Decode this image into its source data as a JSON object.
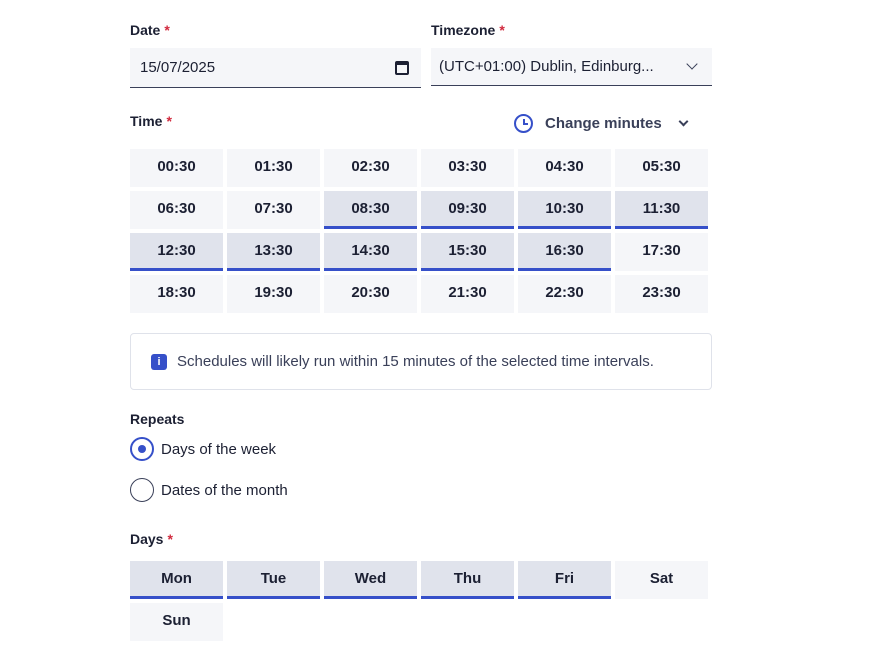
{
  "date": {
    "label": "Date",
    "required_mark": "*",
    "value": "15/07/2025",
    "icon": "calendar-icon"
  },
  "timezone": {
    "label": "Timezone",
    "required_mark": "*",
    "value": "(UTC+01:00) Dublin, Edinburg...",
    "icon": "chevron-down-icon"
  },
  "time": {
    "label": "Time",
    "required_mark": "*",
    "change_minutes": {
      "label": "Change minutes",
      "icon": "clock-icon"
    },
    "slots": [
      {
        "label": "00:30",
        "selected": false
      },
      {
        "label": "01:30",
        "selected": false
      },
      {
        "label": "02:30",
        "selected": false
      },
      {
        "label": "03:30",
        "selected": false
      },
      {
        "label": "04:30",
        "selected": false
      },
      {
        "label": "05:30",
        "selected": false
      },
      {
        "label": "06:30",
        "selected": false
      },
      {
        "label": "07:30",
        "selected": false
      },
      {
        "label": "08:30",
        "selected": true
      },
      {
        "label": "09:30",
        "selected": true
      },
      {
        "label": "10:30",
        "selected": true
      },
      {
        "label": "11:30",
        "selected": true
      },
      {
        "label": "12:30",
        "selected": true
      },
      {
        "label": "13:30",
        "selected": true
      },
      {
        "label": "14:30",
        "selected": true
      },
      {
        "label": "15:30",
        "selected": true
      },
      {
        "label": "16:30",
        "selected": true
      },
      {
        "label": "17:30",
        "selected": false
      },
      {
        "label": "18:30",
        "selected": false
      },
      {
        "label": "19:30",
        "selected": false
      },
      {
        "label": "20:30",
        "selected": false
      },
      {
        "label": "21:30",
        "selected": false
      },
      {
        "label": "22:30",
        "selected": false
      },
      {
        "label": "23:30",
        "selected": false
      }
    ]
  },
  "info": {
    "icon_glyph": "i",
    "text": "Schedules will likely run within 15 minutes of the selected time intervals."
  },
  "repeats": {
    "label": "Repeats",
    "options": [
      {
        "label": "Days of the week",
        "checked": true
      },
      {
        "label": "Dates of the month",
        "checked": false
      }
    ]
  },
  "days": {
    "label": "Days",
    "required_mark": "*",
    "items": [
      {
        "label": "Mon",
        "selected": true
      },
      {
        "label": "Tue",
        "selected": true
      },
      {
        "label": "Wed",
        "selected": true
      },
      {
        "label": "Thu",
        "selected": true
      },
      {
        "label": "Fri",
        "selected": true
      },
      {
        "label": "Sat",
        "selected": false
      },
      {
        "label": "Sun",
        "selected": false
      }
    ]
  },
  "colors": {
    "accent": "#3650c9",
    "required": "#d1293d",
    "selected_bg": "#e0e3ec",
    "unselected_bg": "#f5f6f9"
  }
}
